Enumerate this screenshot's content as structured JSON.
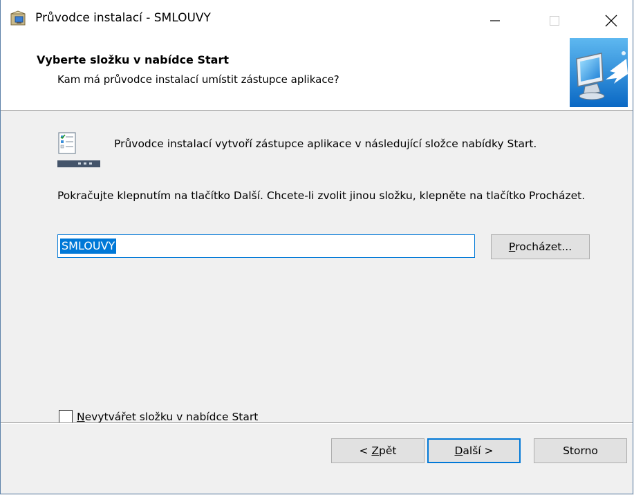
{
  "window": {
    "title": "Průvodce instalací - SMLOUVY"
  },
  "title_bar": {
    "icon": "installer-icon",
    "minimize_icon": "minimize-icon",
    "maximize_icon": "maximize-icon",
    "close_icon": "close-icon"
  },
  "header": {
    "title": "Vyberte složku v nabídce Start",
    "subtitle": "Kam má průvodce instalací umístit zástupce aplikace?",
    "image": "setup-computer-arrow-image"
  },
  "body": {
    "info_icon": "start-menu-folder-icon",
    "info_text": "Průvodce instalací vytvoří zástupce aplikace v následující složce nabídky Start.",
    "instruction_text": "Pokračujte klepnutím na tlačítko Další. Chcete-li zvolit jinou složku, klepněte na tlačítko Procházet.",
    "folder_value": "SMLOUVY",
    "browse_label": "Procházet...",
    "browse_accel": "P",
    "browse_rest": "rocházet...",
    "checkbox_label": "Nevytvářet složku v nabídce Start",
    "checkbox_accel": "N",
    "checkbox_rest": "evytvářet složku v nabídce Start",
    "checkbox_checked": false
  },
  "footer": {
    "back_pre": "< ",
    "back_accel": "Z",
    "back_rest": "pět",
    "next_accel": "D",
    "next_rest": "alší >",
    "cancel_label": "Storno"
  },
  "colors": {
    "accent": "#0078d7",
    "header_bg": "#ffffff",
    "dialog_bg": "#f0f0f0"
  }
}
